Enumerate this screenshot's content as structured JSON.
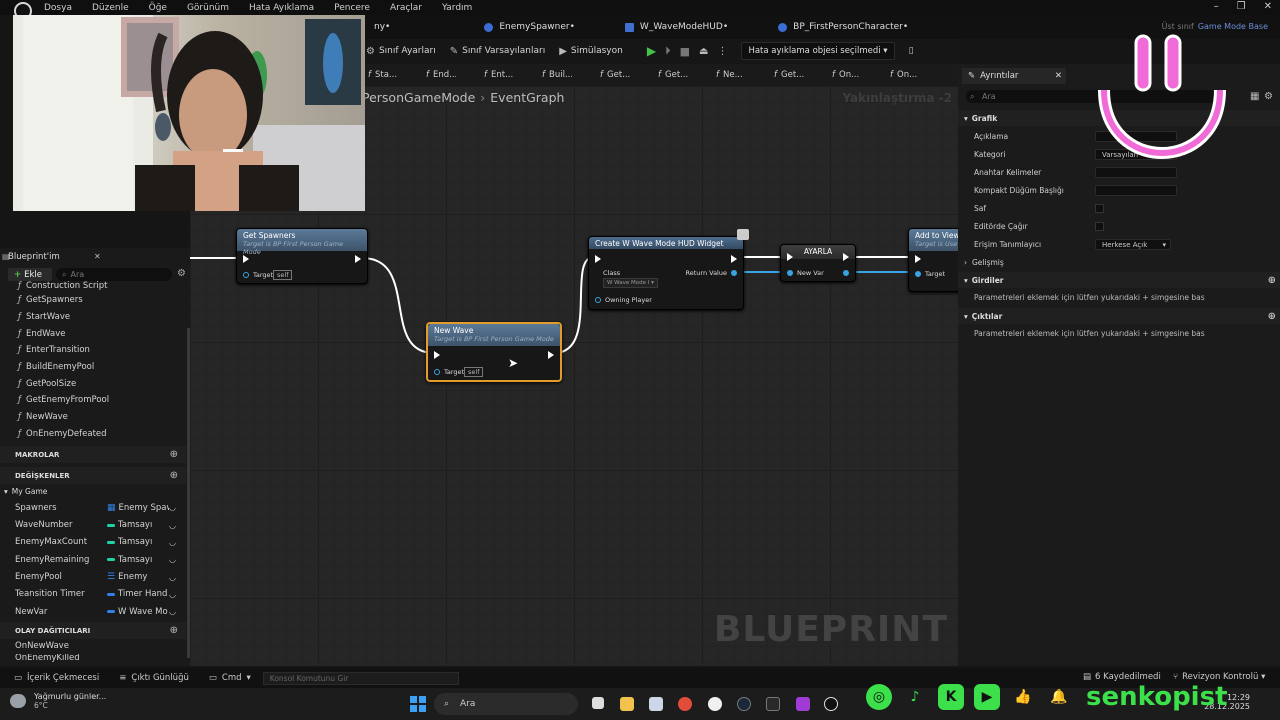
{
  "menu": [
    "Dosya",
    "Düzenle",
    "Öğe",
    "Görünüm",
    "Hata Ayıklama",
    "Pencere",
    "Araçlar",
    "Yardım"
  ],
  "doc_tabs": [
    {
      "label": "ny•"
    },
    {
      "label": "EnemySpawner•"
    },
    {
      "label": "W_WaveModeHUD•"
    },
    {
      "label": "BP_FirstPersonCharacter•"
    }
  ],
  "parent_class": {
    "label": "Üst sınıf",
    "value": "Game Mode Base"
  },
  "toolbar": {
    "class_settings": "Sınıf Ayarları",
    "class_defaults": "Sınıf Varsayılanları",
    "simulation": "Simülasyon",
    "debug_select": "Hata ayıklama objesi seçilmedi"
  },
  "fn_tabs": [
    "Sta...",
    "End...",
    "Ent...",
    "Buil...",
    "Get...",
    "Get...",
    "Ne...",
    "Get...",
    "On...",
    "On..."
  ],
  "graph": {
    "breadcrumb_parent": "PersonGameMode",
    "breadcrumb_current": "EventGraph",
    "zoom": "Yakınlaştırma -2",
    "watermark": "BLUEPRINT"
  },
  "nodes": {
    "get_spawners": {
      "title": "Get Spawners",
      "subtitle": "Target is BP First Person Game Mode",
      "pin_target": "Target",
      "self": "self"
    },
    "new_wave": {
      "title": "New Wave",
      "subtitle": "Target is BP First Person Game Mode",
      "pin_target": "Target",
      "self": "self"
    },
    "create_widget": {
      "title": "Create W Wave Mode HUD Widget",
      "pin_class": "Class",
      "class_value": "W Wave Mode I",
      "pin_return": "Return Value",
      "pin_owning": "Owning Player"
    },
    "set_var": {
      "title": "AYARLA",
      "pin_newvar": "New Var"
    },
    "add_to_view": {
      "title": "Add to View",
      "subtitle": "Target is Use",
      "pin_target": "Target"
    }
  },
  "left_panel": {
    "title": "Blueprint'im",
    "add": "Ekle",
    "search_placeholder": "Ara",
    "functions": [
      "Construction Script",
      "GetSpawners",
      "StartWave",
      "EndWave",
      "EnterTransition",
      "BuildEnemyPool",
      "GetPoolSize",
      "GetEnemyFromPool",
      "NewWave",
      "OnEnemyDefeated"
    ],
    "sections": {
      "macros": "MAKROLAR",
      "variables": "DEĞİŞKENLER",
      "dispatchers": "OLAY DAĞITICILARI"
    },
    "var_category": "My Game",
    "variables": [
      {
        "name": "Spawners",
        "type": "Enemy Spaw",
        "color": "#2f82e6"
      },
      {
        "name": "WaveNumber",
        "type": "Tamsayı",
        "color": "#1fd3a6"
      },
      {
        "name": "EnemyMaxCount",
        "type": "Tamsayı",
        "color": "#1fd3a6"
      },
      {
        "name": "EnemyRemaining",
        "type": "Tamsayı",
        "color": "#1fd3a6"
      },
      {
        "name": "EnemyPool",
        "type": "Enemy",
        "color": "#2f82e6"
      },
      {
        "name": "Teansition Timer",
        "type": "Timer Hand",
        "color": "#2f82e6"
      },
      {
        "name": "NewVar",
        "type": "W Wave Mo",
        "color": "#2f82e6"
      }
    ],
    "dispatchers": [
      "OnNewWave",
      "OnEnemyKilled"
    ]
  },
  "details": {
    "tab": "Ayrıntılar",
    "search_placeholder": "Ara",
    "graph_section": "Grafik",
    "rows": {
      "description": "Açıklama",
      "category": "Kategori",
      "category_value": "Varsayılan",
      "keywords": "Anahtar Kelimeler",
      "compact_title": "Kompakt Düğüm Başlığı",
      "pure": "Saf",
      "call_in_editor": "Editörde Çağır",
      "access": "Erişim Tanımlayıcı",
      "access_value": "Herkese Açık"
    },
    "advanced": "Gelişmiş",
    "inputs": "Girdiler",
    "inputs_hint": "Parametreleri eklemek için lütfen yukarıdaki + simgesine bas",
    "outputs": "Çıktılar",
    "outputs_hint": "Parametreleri eklemek için lütfen yukarıdaki + simgesine bas"
  },
  "bottombar": {
    "content_drawer": "İçerik Çekmecesi",
    "output_log": "Çıktı Günlüğü",
    "cmd": "Cmd",
    "console_placeholder": "Konsol Komutunu Gir",
    "saved": "6 Kaydedilmedi",
    "revision": "Revizyon Kontrolü"
  },
  "taskbar": {
    "weather_text": "Yağmurlu günler...",
    "weather_temp": "6°C",
    "search": "Ara",
    "time": "12:29",
    "date": "28.12.2025"
  },
  "overlay": {
    "brand": "senkopist"
  },
  "colors": {
    "exec_wire": "#ffffff",
    "object_wire": "#3aa3e3",
    "selection": "#e39b2c",
    "green": "#3be04a"
  }
}
